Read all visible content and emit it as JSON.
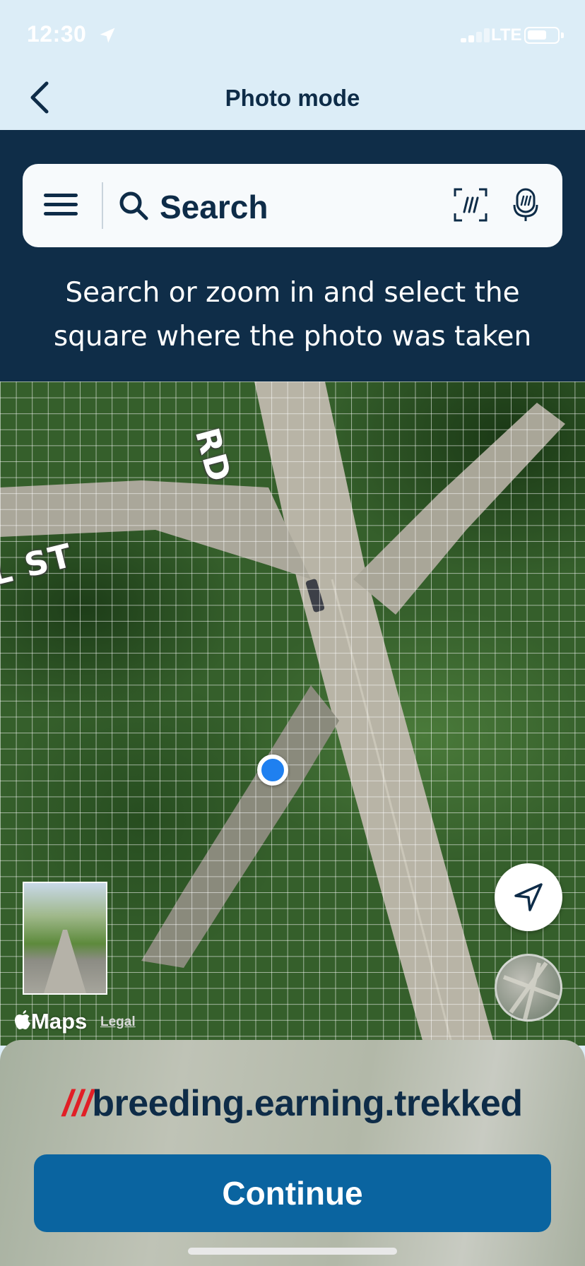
{
  "status_bar": {
    "time": "12:30",
    "network": "LTE",
    "icons": [
      "location-arrow-icon",
      "signal-icon",
      "battery-icon"
    ]
  },
  "nav": {
    "title": "Photo mode",
    "back_icon": "chevron-left-icon"
  },
  "search": {
    "placeholder": "Search",
    "icons": [
      "menu-icon",
      "search-icon",
      "scan-icon",
      "microphone-icon"
    ]
  },
  "instruction": "Search or zoom in and select the square where the photo was taken",
  "map": {
    "street_labels": [
      "L ST",
      "RD"
    ],
    "provider": "Maps",
    "legal_link": "Legal",
    "buttons": [
      "locate-me-button",
      "map-view-toggle"
    ]
  },
  "result": {
    "prefix": "///",
    "address": "breeding.earning.trekked"
  },
  "continue_label": "Continue",
  "colors": {
    "navy": "#0e2c48",
    "panel": "#0f2d48",
    "primary_button": "#0a64a0",
    "w3w_red": "#e11f26",
    "location_dot": "#1f80f0"
  }
}
